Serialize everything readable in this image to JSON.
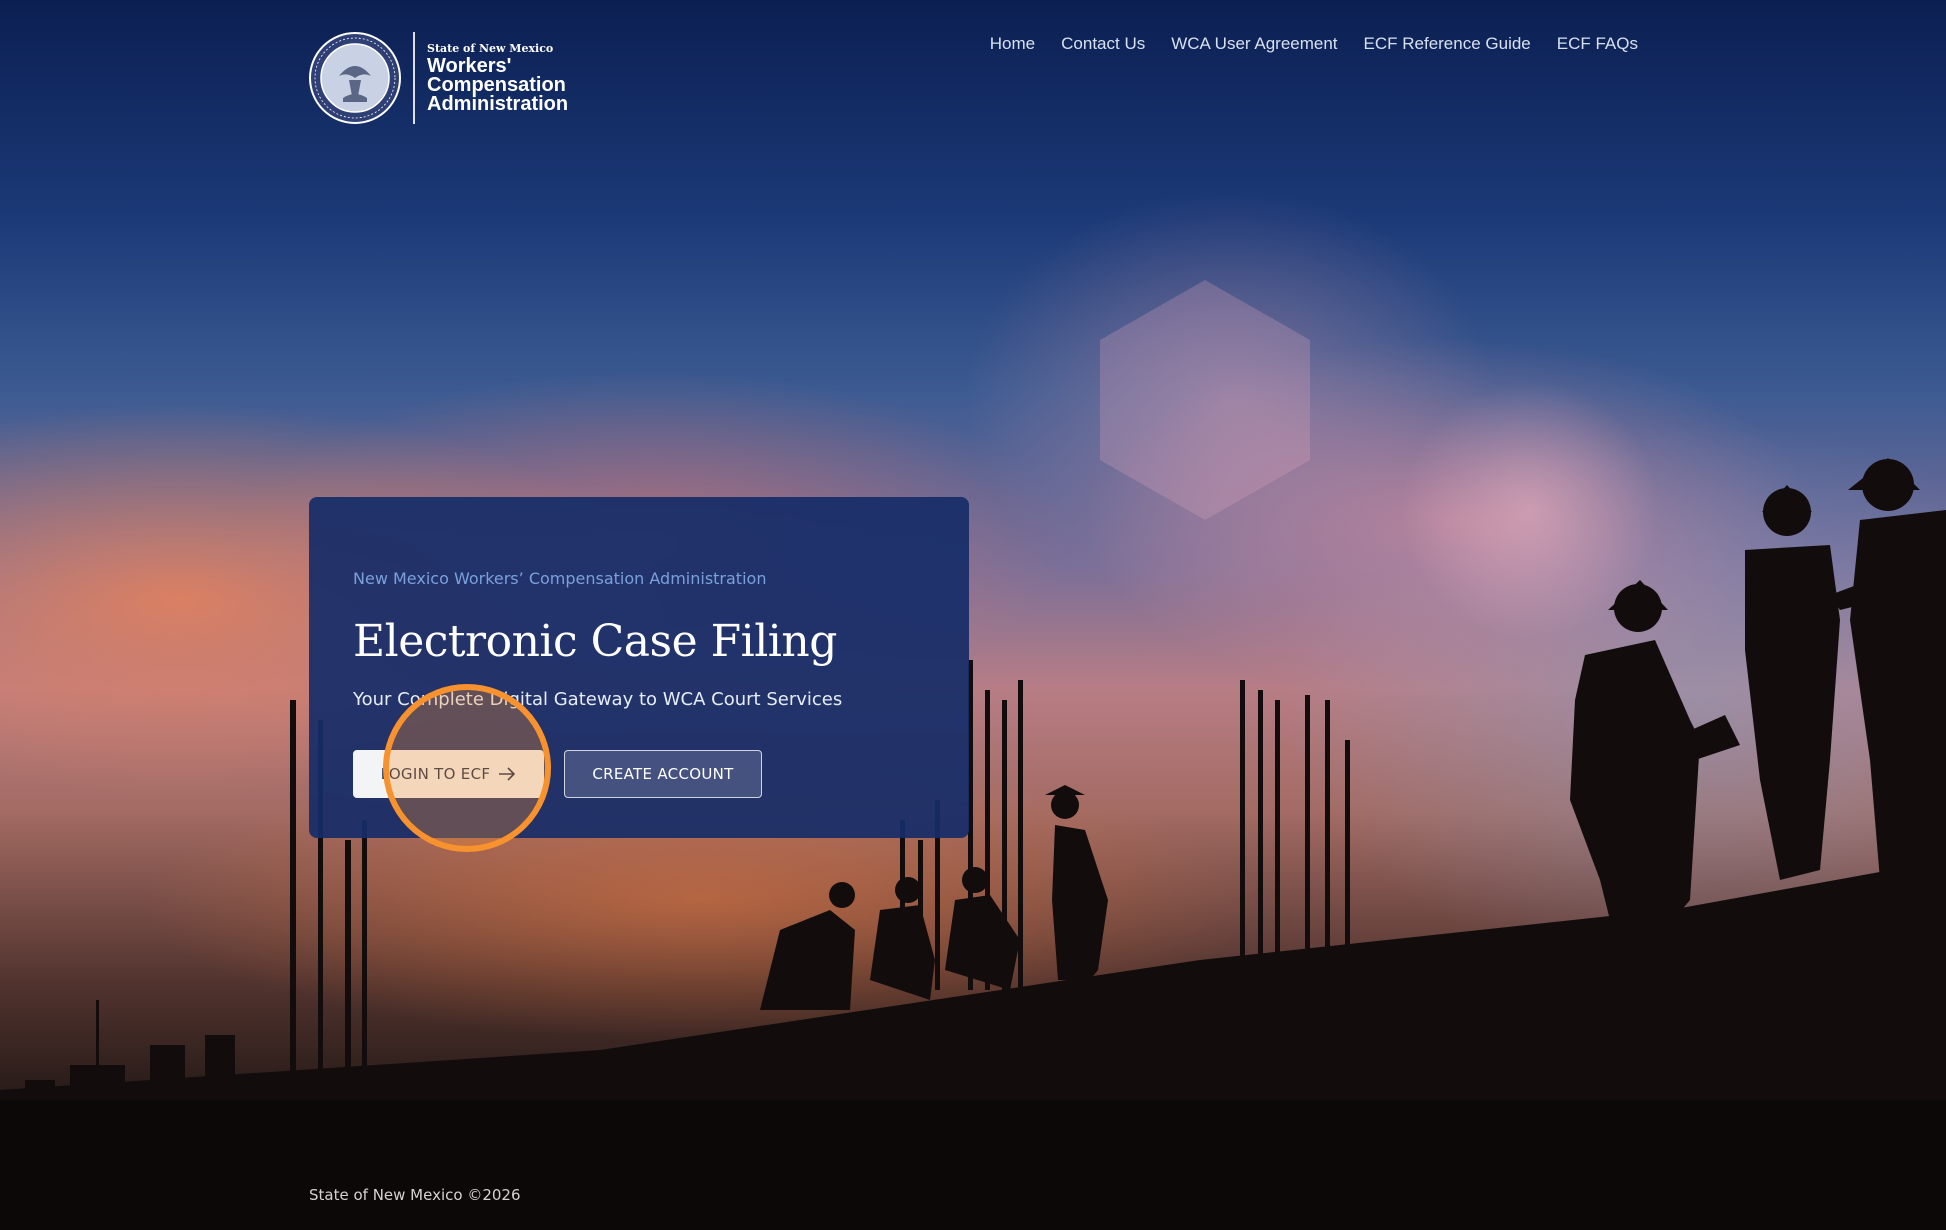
{
  "header": {
    "logo": {
      "small_text": "State of New Mexico",
      "line1": "Workers'",
      "line2": "Compensation",
      "line3": "Administration",
      "seal_icon": "great-seal-of-new-mexico"
    },
    "nav": [
      {
        "label": "Home"
      },
      {
        "label": "Contact Us"
      },
      {
        "label": "WCA User Agreement"
      },
      {
        "label": "ECF Reference Guide"
      },
      {
        "label": "ECF FAQs"
      }
    ]
  },
  "hero": {
    "kicker": "New Mexico Workers’ Compensation Administration",
    "title": "Electronic Case Filing",
    "subtitle": "Your Complete Digital Gateway to WCA Court Services",
    "login_button": "LOGIN TO ECF",
    "login_icon": "arrow-right-icon",
    "create_button": "CREATE ACCOUNT"
  },
  "footer": {
    "copyright": "State of New Mexico ©2026"
  },
  "colors": {
    "card_bg": "#162c68",
    "kicker": "#7aa1dc",
    "highlight": "#f7922e"
  }
}
